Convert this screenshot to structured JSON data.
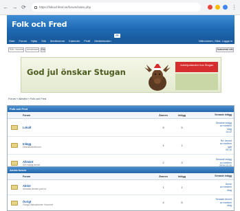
{
  "browser": {
    "url": "https://folkochfred.se/forum/index.php",
    "back": "←",
    "forward": "→",
    "reload": "⟳",
    "menu": "⋮",
    "ext_colors": [
      "#e8453c",
      "#fbbc05",
      "#4285f4"
    ]
  },
  "site": {
    "title": "Folk och Fred",
    "badge": "FF",
    "menu": [
      "Start",
      "Forum",
      "Hjälp",
      "Sök",
      "Medlemmar",
      "Kalender",
      "Profil",
      "Meddelanden"
    ],
    "welcome": "Välkommen, Gäst. Logga in",
    "search_placeholder": "Sök i forumet",
    "search2": "Användare",
    "go": "Go",
    "right_button": "Avancerad sök"
  },
  "banner": {
    "text": "God jul önskar Stugan",
    "box_text": "Julerbjudanden hos Stugan"
  },
  "breadcrumb": "Forum » Allmänt » Folk och Fred",
  "sections": [
    {
      "title": "Folk och Fred",
      "columns": [
        "Forum",
        "Ämnen",
        "Inlägg",
        "Senaste inlägg"
      ],
      "rows": [
        {
          "name": "Lokalt",
          "desc": "",
          "topics": "5",
          "posts": "5",
          "last": [
            "Senaste inlägg",
            "av medlem",
            "Idag",
            "14:22"
          ]
        },
        {
          "name": "Inlägg",
          "desc": "Diskussionsforum",
          "topics": "1",
          "posts": "1",
          "last": [
            "Re: ämnet",
            "av medlem",
            "Igår",
            "09:10"
          ]
        },
        {
          "name": "Allmänt",
          "desc": "Allt möjligt annat",
          "topics": "2",
          "posts": "3",
          "last": [
            "Senaste inlägg",
            "av medlem",
            "2019-12-20"
          ]
        }
      ]
    },
    {
      "title": "Andra forum",
      "columns": [
        "Forum",
        "Ämnen",
        "Inlägg",
        "Senaste inlägg"
      ],
      "rows": [
        {
          "name": "Aktivt",
          "desc": "Aktuella ämnen just nu",
          "topics": "1",
          "posts": "1",
          "last": [
            "Ämne",
            "av medlem",
            "Idag"
          ]
        },
        {
          "name": "Övrigt",
          "desc": "Övriga diskussioner i forumet",
          "topics": "4",
          "posts": "6",
          "last": [
            "Senaste ämnet",
            "av medlem",
            "Idag"
          ]
        }
      ]
    }
  ]
}
